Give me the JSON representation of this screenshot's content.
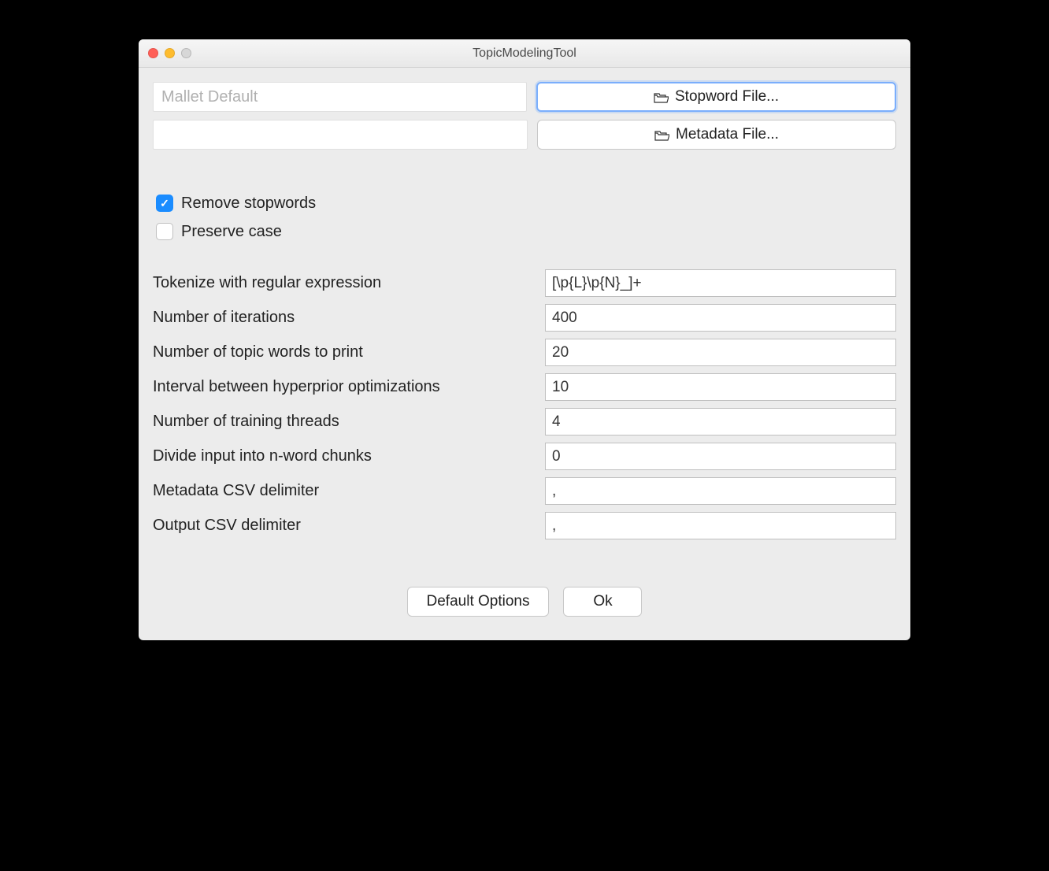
{
  "window": {
    "title": "TopicModelingTool"
  },
  "files": {
    "stopword": {
      "display": "Mallet Default",
      "button": "Stopword File..."
    },
    "metadata": {
      "display": "",
      "button": "Metadata File..."
    }
  },
  "checkboxes": {
    "remove_stopwords": {
      "label": "Remove stopwords",
      "checked": true
    },
    "preserve_case": {
      "label": "Preserve case",
      "checked": false
    }
  },
  "fields": {
    "tokenize": {
      "label": "Tokenize with regular expression",
      "value": "[\\p{L}\\p{N}_]+"
    },
    "iterations": {
      "label": "Number of iterations",
      "value": "400"
    },
    "topic_words": {
      "label": "Number of topic words to print",
      "value": "20"
    },
    "hyperprior": {
      "label": "Interval between hyperprior optimizations",
      "value": "10"
    },
    "threads": {
      "label": "Number of training threads",
      "value": "4"
    },
    "chunks": {
      "label": "Divide input into n-word chunks",
      "value": "0"
    },
    "meta_delim": {
      "label": "Metadata CSV delimiter",
      "value": ","
    },
    "out_delim": {
      "label": "Output CSV delimiter",
      "value": ","
    }
  },
  "buttons": {
    "default": "Default Options",
    "ok": "Ok"
  }
}
